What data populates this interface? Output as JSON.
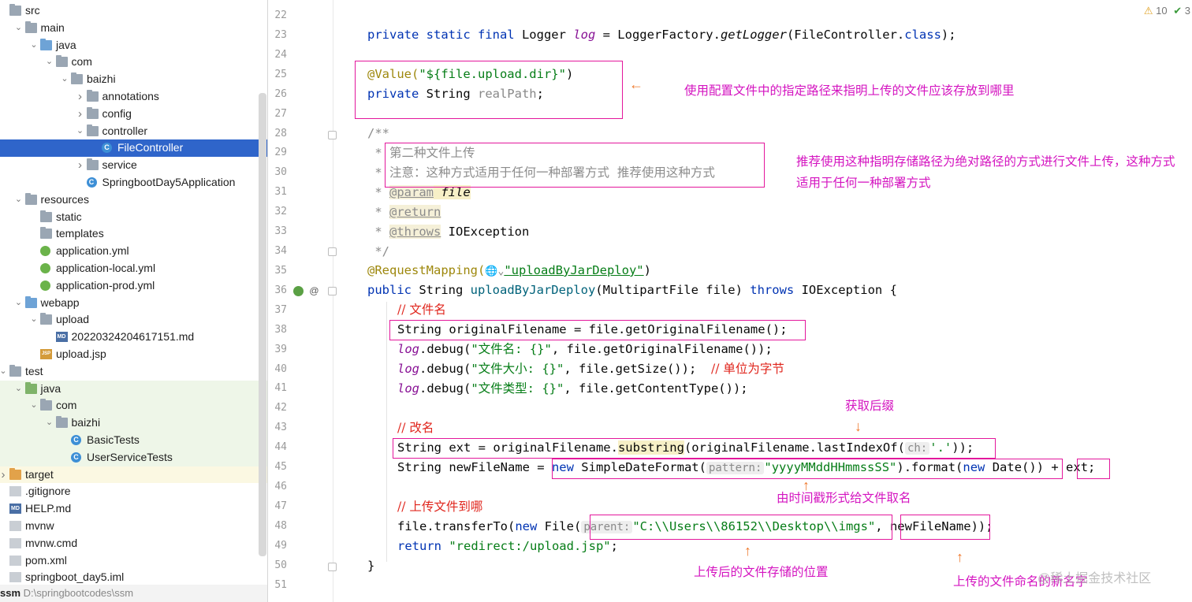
{
  "tree": {
    "rows": [
      {
        "label": "src",
        "indent": 0,
        "arrow": "",
        "icon": "folder"
      },
      {
        "label": "main",
        "indent": 1,
        "arrow": "v",
        "icon": "folder"
      },
      {
        "label": "java",
        "indent": 2,
        "arrow": "v",
        "icon": "folder-blue"
      },
      {
        "label": "com",
        "indent": 3,
        "arrow": "v",
        "icon": "folder"
      },
      {
        "label": "baizhi",
        "indent": 4,
        "arrow": "v",
        "icon": "folder"
      },
      {
        "label": "annotations",
        "indent": 5,
        "arrow": ">",
        "icon": "folder"
      },
      {
        "label": "config",
        "indent": 5,
        "arrow": ">",
        "icon": "folder"
      },
      {
        "label": "controller",
        "indent": 5,
        "arrow": "v",
        "icon": "folder"
      },
      {
        "label": "FileController",
        "indent": 6,
        "arrow": "",
        "icon": "class",
        "selected": true
      },
      {
        "label": "service",
        "indent": 5,
        "arrow": ">",
        "icon": "folder"
      },
      {
        "label": "SpringbootDay5Application",
        "indent": 5,
        "arrow": "",
        "icon": "class"
      },
      {
        "label": "resources",
        "indent": 1,
        "arrow": "v",
        "icon": "folder-res"
      },
      {
        "label": "static",
        "indent": 2,
        "arrow": "",
        "icon": "folder"
      },
      {
        "label": "templates",
        "indent": 2,
        "arrow": "",
        "icon": "folder"
      },
      {
        "label": "application.yml",
        "indent": 2,
        "arrow": "",
        "icon": "yml"
      },
      {
        "label": "application-local.yml",
        "indent": 2,
        "arrow": "",
        "icon": "yml"
      },
      {
        "label": "application-prod.yml",
        "indent": 2,
        "arrow": "",
        "icon": "yml"
      },
      {
        "label": "webapp",
        "indent": 1,
        "arrow": "v",
        "icon": "folder-blue"
      },
      {
        "label": "upload",
        "indent": 2,
        "arrow": "v",
        "icon": "folder"
      },
      {
        "label": "20220324204617151.md",
        "indent": 3,
        "arrow": "",
        "icon": "md"
      },
      {
        "label": "upload.jsp",
        "indent": 2,
        "arrow": "",
        "icon": "jsp"
      },
      {
        "label": "test",
        "indent": 0,
        "arrow": "v",
        "icon": "folder"
      },
      {
        "label": "java",
        "indent": 1,
        "arrow": "v",
        "icon": "folder-green",
        "test": true
      },
      {
        "label": "com",
        "indent": 2,
        "arrow": "v",
        "icon": "folder",
        "test": true
      },
      {
        "label": "baizhi",
        "indent": 3,
        "arrow": "v",
        "icon": "folder",
        "test": true
      },
      {
        "label": "BasicTests",
        "indent": 4,
        "arrow": "",
        "icon": "class",
        "test": true
      },
      {
        "label": "UserServiceTests",
        "indent": 4,
        "arrow": "",
        "icon": "class",
        "test": true
      },
      {
        "label": "target",
        "indent": 0,
        "arrow": ">",
        "icon": "folder-orange",
        "target": true
      },
      {
        "label": ".gitignore",
        "indent": 0,
        "arrow": "",
        "icon": "file"
      },
      {
        "label": "HELP.md",
        "indent": 0,
        "arrow": "",
        "icon": "md"
      },
      {
        "label": "mvnw",
        "indent": 0,
        "arrow": "",
        "icon": "file"
      },
      {
        "label": "mvnw.cmd",
        "indent": 0,
        "arrow": "",
        "icon": "file"
      },
      {
        "label": "pom.xml",
        "indent": 0,
        "arrow": "",
        "icon": "file"
      },
      {
        "label": "springboot_day5.iml",
        "indent": 0,
        "arrow": "",
        "icon": "file"
      }
    ],
    "bottom_name": "ssm",
    "bottom_path": "D:\\springbootcodes\\ssm"
  },
  "editor": {
    "line_numbers": [
      "22",
      "23",
      "24",
      "25",
      "26",
      "27",
      "28",
      "29",
      "30",
      "31",
      "32",
      "33",
      "34",
      "35",
      "36",
      "37",
      "38",
      "39",
      "40",
      "41",
      "42",
      "43",
      "44",
      "45",
      "46",
      "47",
      "48",
      "49",
      "50",
      "51"
    ],
    "lines": {
      "l23": {
        "kw": "private static final",
        "a": " Logger ",
        "log": "log",
        "b": " = LoggerFactory.",
        "m": "getLogger",
        "c": "(FileController.",
        "cls": "class",
        "d": ");"
      },
      "l25": {
        "an": "@Value(",
        "st": "\"${file.upload.dir}\"",
        "end": ")"
      },
      "l26": {
        "kw": "private",
        "a": " String ",
        "f": "realPath",
        "end": ";"
      },
      "l28": "/**",
      "l29": {
        "star": " * ",
        "t": "第二种文件上传"
      },
      "l30": {
        "star": " * ",
        "t": "注意：这种方式适用于任何一种部署方式  推荐使用这种方式"
      },
      "l31": {
        "star": " * ",
        "tag": "@param",
        "sp": " ",
        "p": "file"
      },
      "l32": {
        "star": " * ",
        "tag": "@return"
      },
      "l33": {
        "star": " * ",
        "tag": "@throws",
        "rest": " IOException"
      },
      "l34": " */",
      "l35": {
        "an": "@RequestMapping(",
        "icons": "🌐⌄",
        "st": "\"uploadByJarDeploy\"",
        "end": ")"
      },
      "l36": {
        "kw": "public",
        "a": " String ",
        "m": "uploadByJarDeploy",
        "b": "(MultipartFile file) ",
        "kw2": "throws",
        "c": " IOException {"
      },
      "l37": "// 文件名",
      "l38": "String originalFilename = file.getOriginalFilename();",
      "l39": {
        "log": "log",
        "a": ".debug(",
        "st": "\"文件名: {}\"",
        "b": ", file.getOriginalFilename());"
      },
      "l40": {
        "log": "log",
        "a": ".debug(",
        "st": "\"文件大小: {}\"",
        "b": ", file.getSize());  ",
        "cm": "// 单位为字节"
      },
      "l41": {
        "log": "log",
        "a": ".debug(",
        "st": "\"文件类型: {}\"",
        "b": ", file.getContentType());"
      },
      "l43": "// 改名",
      "l44": {
        "a": "String ext = originalFilename.",
        "m": "substring",
        "b": "(originalFilename.lastIndexOf(",
        "hint": "ch:",
        "st": "'.'",
        "c": "));"
      },
      "l45": {
        "a": "String newFileName = ",
        "kw": "new",
        "b": " SimpleDateFormat(",
        "hint": "pattern:",
        "st": "\"yyyyMMddHHmmssSS\"",
        "c": ").format(",
        "kw2": "new",
        "d": " Date()) + ext;"
      },
      "l47": "// 上传文件到哪",
      "l48": {
        "a": "file.transferTo(",
        "kw": "new",
        "b": " File(",
        "hint": "parent:",
        "st": "\"C:\\\\Users\\\\86152\\\\Desktop\\\\imgs\"",
        "c": ", newFileName));"
      },
      "l49": {
        "kw": "return",
        "st": " \"redirect:/upload.jsp\"",
        "end": ";"
      },
      "l50": "}"
    }
  },
  "annotations": {
    "n1": "使用配置文件中的指定路径来指明上传的文件应该存放到哪里",
    "n2": "推荐使用这种指明存储路径为绝对路径的方式进行文件上传，这种方式适用于任何一种部署方式",
    "n3": "获取后缀",
    "n4": "由时间戳形式给文件取名",
    "n5": "上传后的文件存储的位置",
    "n6": "上传的文件命名的新名字"
  },
  "status": {
    "warnings": "10",
    "checks": "3"
  },
  "watermark": "@稀土掘金技术社区",
  "gutter_icons": {
    "at": "@"
  },
  "colors": {
    "selection": "#2f65ca",
    "annotation": "#e3179c",
    "note_text": "#d414c0",
    "arrow": "#ef7a2e"
  }
}
